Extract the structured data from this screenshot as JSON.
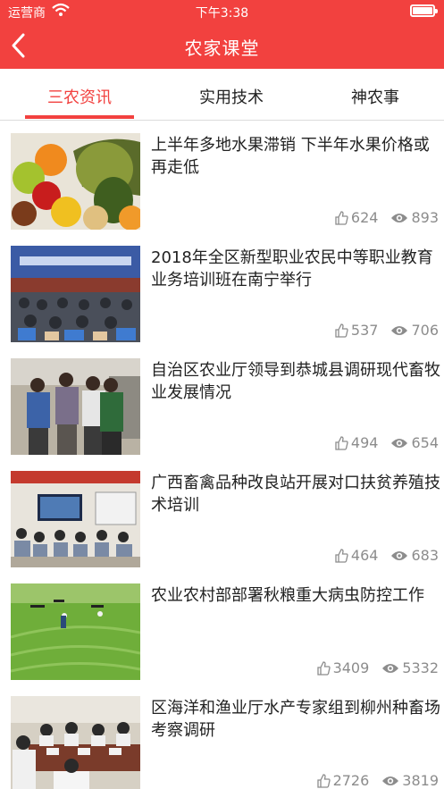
{
  "status_bar": {
    "carrier": "运营商",
    "time": "下午3:38"
  },
  "header": {
    "title": "农家课堂"
  },
  "tabs": [
    {
      "label": "三农资讯",
      "active": true
    },
    {
      "label": "实用技术",
      "active": false
    },
    {
      "label": "神农事",
      "active": false
    }
  ],
  "colors": {
    "accent": "#f2413f",
    "meta_text": "#8c8c8c"
  },
  "icons": {
    "back": "chevron-left-icon",
    "likes": "thumbs-up-icon",
    "views": "eye-icon",
    "wifi": "wifi-icon",
    "battery": "battery-icon"
  },
  "news": [
    {
      "title": "上半年多地水果滞销  下半年水果价格或再走低",
      "likes": "624",
      "views": "893",
      "image": "fruit-pile"
    },
    {
      "title": "2018年全区新型职业农民中等职业教育业务培训班在南宁举行",
      "likes": "537",
      "views": "706",
      "image": "conference-hall"
    },
    {
      "title": "自治区农业厅领导到恭城县调研现代畜牧业发展情况",
      "likes": "494",
      "views": "654",
      "image": "officials-visit"
    },
    {
      "title": "广西畜禽品种改良站开展对口扶贫养殖技术培训",
      "likes": "464",
      "views": "683",
      "image": "training-classroom"
    },
    {
      "title": "农业农村部部署秋粮重大病虫防控工作",
      "likes": "3409",
      "views": "5332",
      "image": "drone-rice-field"
    },
    {
      "title": "区海洋和渔业厅水产专家组到柳州种畜场考察调研",
      "likes": "2726",
      "views": "3819",
      "image": "meeting-table"
    }
  ]
}
